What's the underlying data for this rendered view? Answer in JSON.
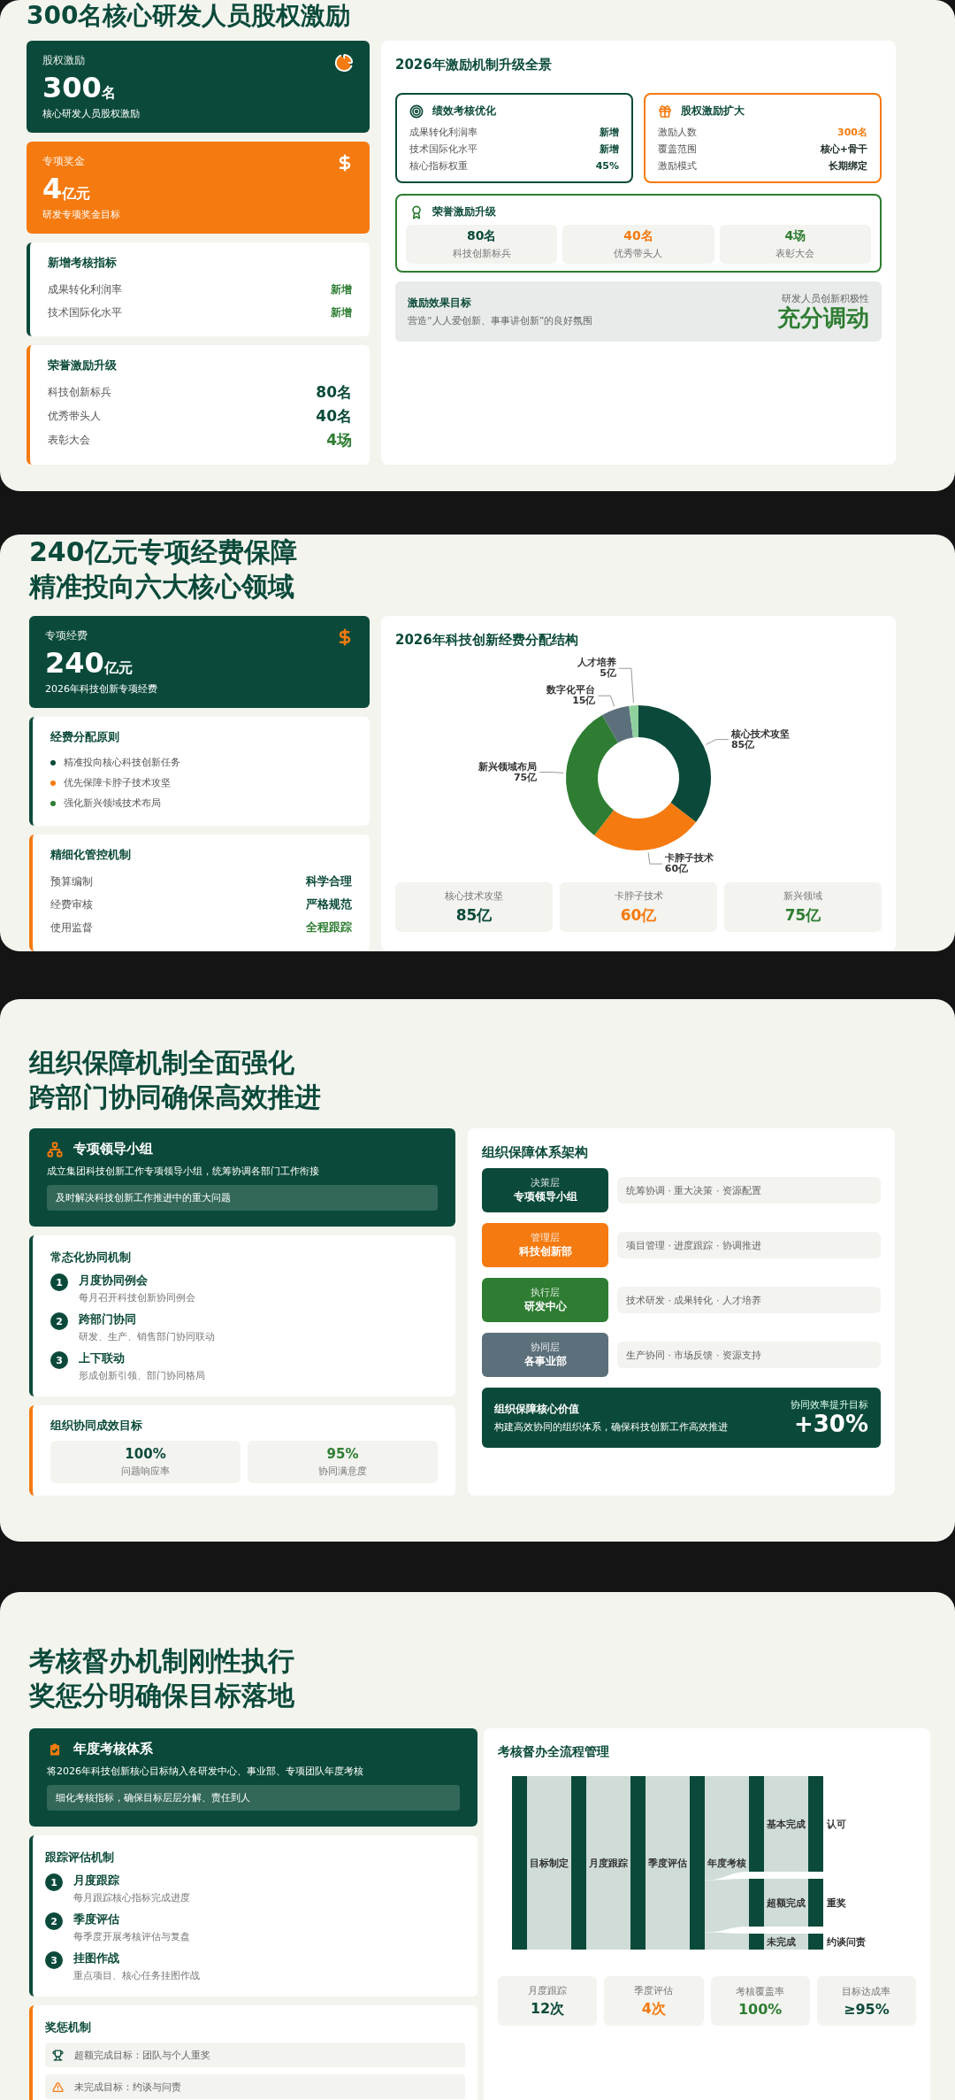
{
  "equity_section": {
    "title": "300名核心研发人员股权激励",
    "kpis": [
      {
        "kind": "dark",
        "label": "股权激励",
        "value": "300",
        "unit": "名",
        "caption": "核心研发人员股权激励"
      },
      {
        "kind": "orange",
        "label": "专项奖金",
        "value": "4",
        "unit": "亿元",
        "caption": "研发专项奖金目标"
      }
    ],
    "metrics": {
      "title": "新增考核指标",
      "rows": [
        {
          "label": "成果转化利润率",
          "value": "新增",
          "color": "#2e7d32"
        },
        {
          "label": "技术国际化水平",
          "value": "新增",
          "color": "#2e7d32"
        }
      ]
    },
    "honors": {
      "title": "荣誉激励升级",
      "rows": [
        {
          "label": "科技创新标兵",
          "value": "80名",
          "color": "#0b4a3a"
        },
        {
          "label": "优秀带头人",
          "value": "40名",
          "color": "#0b4a3a"
        },
        {
          "label": "表彰大会",
          "value": "4场",
          "color": "#2e7d32"
        }
      ]
    },
    "overview": {
      "title": "2026年激励机制升级全景",
      "performance": {
        "title": "绩效考核优化",
        "rows": [
          {
            "label": "成果转化利润率",
            "value": "新增",
            "color": "#0b4a3a"
          },
          {
            "label": "技术国际化水平",
            "value": "新增",
            "color": "#0b4a3a"
          },
          {
            "label": "核心指标权重",
            "value": "45%",
            "color": "#0b4a3a"
          }
        ]
      },
      "equity": {
        "title": "股权激励扩大",
        "rows": [
          {
            "label": "激励人数",
            "value": "300名",
            "color": "#f57a0f"
          },
          {
            "label": "覆盖范围",
            "value": "核心+骨干",
            "color": "#1a2a24"
          },
          {
            "label": "激励模式",
            "value": "长期绑定",
            "color": "#1a2a24"
          }
        ]
      },
      "honor": {
        "title": "荣誉激励升级",
        "stats": [
          {
            "value": "80名",
            "label": "科技创新标兵",
            "color": "#0b4a3a"
          },
          {
            "value": "40名",
            "label": "优秀带头人",
            "color": "#f57a0f"
          },
          {
            "value": "4场",
            "label": "表彰大会",
            "color": "#2e7d32"
          }
        ]
      },
      "goal": {
        "title": "激励效果目标",
        "text": "营造“人人爱创新、事事讲创新”的良好氛围",
        "side_label": "研发人员创新积极性",
        "side_value": "充分调动"
      }
    }
  },
  "funding_section": {
    "title_lines": [
      "240亿元专项经费保障",
      "精准投向六大核心领域"
    ],
    "kpi": {
      "label": "专项经费",
      "value": "240",
      "unit": "亿元",
      "caption": "2026年科技创新专项经费"
    },
    "principles": {
      "title": "经费分配原则",
      "items": [
        {
          "text": "精准投向核心科技创新任务",
          "color": "#0b4a3a"
        },
        {
          "text": "优先保障卡脖子技术攻坚",
          "color": "#f57a0f"
        },
        {
          "text": "强化新兴领域技术布局",
          "color": "#2e7d32"
        }
      ]
    },
    "controls": {
      "title": "精细化管控机制",
      "rows": [
        {
          "label": "预算编制",
          "value": "科学合理",
          "color": "#0b4a3a"
        },
        {
          "label": "经费审核",
          "value": "严格规范",
          "color": "#0b4a3a"
        },
        {
          "label": "使用监督",
          "value": "全程跟踪",
          "color": "#2e7d32"
        }
      ]
    },
    "chart_panel": {
      "chart_data": {
        "type": "donut",
        "title": "2026年科技创新经费分配结构",
        "categories": [
          "核心技术攻坚",
          "卡脖子技术",
          "新兴领域布局",
          "数字化平台",
          "人才培养"
        ],
        "values": [
          85,
          60,
          75,
          15,
          5
        ],
        "colors": [
          "#0b4a3a",
          "#f57a0f",
          "#2e7d32",
          "#5c707c",
          "#8fd19e"
        ],
        "value_labels": [
          "85亿",
          "60亿",
          "75亿",
          "15亿",
          "5亿"
        ]
      },
      "stats": [
        {
          "label": "核心技术攻坚",
          "value": "85亿",
          "color": "#0b4a3a"
        },
        {
          "label": "卡脖子技术",
          "value": "60亿",
          "color": "#f57a0f"
        },
        {
          "label": "新兴领域",
          "value": "75亿",
          "color": "#2e7d32"
        }
      ]
    }
  },
  "organization_section": {
    "title_lines": [
      "组织保障机制全面强化",
      "跨部门协同确保高效推进"
    ],
    "leader": {
      "title": "专项领导小组",
      "text": "成立集团科技创新工作专项领导小组，统筹协调各部门工作衔接",
      "note": "及时解决科技创新工作推进中的重大问题"
    },
    "mechanism": {
      "title": "常态化协同机制",
      "steps": [
        {
          "number": "1",
          "title": "月度协同例会",
          "text": "每月召开科技创新协同例会"
        },
        {
          "number": "2",
          "title": "跨部门协同",
          "text": "研发、生产、销售部门协同联动"
        },
        {
          "number": "3",
          "title": "上下联动",
          "text": "形成创新引领、部门协同格局"
        }
      ]
    },
    "goals": {
      "title": "组织协同成效目标",
      "stats": [
        {
          "value": "100%",
          "label": "问题响应率",
          "color": "#0b4a3a"
        },
        {
          "value": "95%",
          "label": "协同满意度",
          "color": "#2e7d32"
        }
      ]
    },
    "architecture": {
      "title": "组织保障体系架构",
      "layers": [
        {
          "tier": "决策层",
          "name": "专项领导小组",
          "duties": "统筹协调 · 重大决策 · 资源配置",
          "color": "#0b4a3a"
        },
        {
          "tier": "管理层",
          "name": "科技创新部",
          "duties": "项目管理 · 进度跟踪 · 协调推进",
          "color": "#f57a0f"
        },
        {
          "tier": "执行层",
          "name": "研发中心",
          "duties": "技术研发 · 成果转化 · 人才培养",
          "color": "#2e7d32"
        },
        {
          "tier": "协同层",
          "name": "各事业部",
          "duties": "生产协同 · 市场反馈 · 资源支持",
          "color": "#5c707c"
        }
      ],
      "value_box": {
        "title": "组织保障核心价值",
        "text": "构建高效协同的组织体系，确保科技创新工作高效推进",
        "side_label": "协同效率提升目标",
        "side_value": "+30%"
      }
    }
  },
  "assessment_section": {
    "title_lines": [
      "考核督办机制刚性执行",
      "奖惩分明确保目标落地"
    ],
    "annual": {
      "title": "年度考核体系",
      "text": "将2026年科技创新核心目标纳入各研发中心、事业部、专项团队年度考核",
      "note": "细化考核指标，确保目标层层分解、责任到人"
    },
    "tracking": {
      "title": "跟踪评估机制",
      "steps": [
        {
          "number": "1",
          "title": "月度跟踪",
          "text": "每月跟踪核心指标完成进度"
        },
        {
          "number": "2",
          "title": "季度评估",
          "text": "每季度开展考核评估与复盘"
        },
        {
          "number": "3",
          "title": "挂图作战",
          "text": "重点项目、核心任务挂图作战"
        }
      ]
    },
    "rewards": {
      "title": "奖惩机制",
      "items": [
        {
          "kind": "reward",
          "text": "超额完成目标：团队与个人重奖"
        },
        {
          "kind": "penalty",
          "text": "未完成目标：约谈与问责"
        }
      ]
    },
    "flow_panel": {
      "title": "考核督办全流程管理",
      "stages": [
        {
          "label": "目标制定"
        },
        {
          "label": "月度跟踪"
        },
        {
          "label": "季度评估"
        },
        {
          "label": "年度考核"
        }
      ],
      "outcomes": [
        {
          "result": "基本完成",
          "action": "认可",
          "level": 0.6
        },
        {
          "result": "超额完成",
          "action": "重奖",
          "level": 0.3
        },
        {
          "result": "未完成",
          "action": "约谈问责",
          "level": 0.1
        }
      ],
      "stats": [
        {
          "label": "月度跟踪",
          "value": "12次",
          "color": "#0b4a3a"
        },
        {
          "label": "季度评估",
          "value": "4次",
          "color": "#f57a0f"
        },
        {
          "label": "考核覆盖率",
          "value": "100%",
          "color": "#2e7d32"
        },
        {
          "label": "目标达成率",
          "value": "≥95%",
          "color": "#0b4a3a"
        }
      ]
    }
  }
}
